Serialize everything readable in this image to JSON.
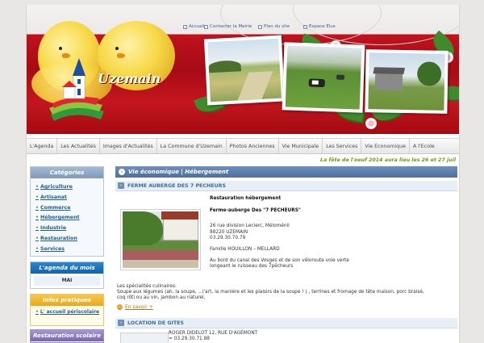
{
  "toplinks": {
    "accueil": "Accueil",
    "contact": "Contacter la Mairie",
    "plan": "Plan du site",
    "espace": "Espace Elus"
  },
  "logo": {
    "text": "Uzemain"
  },
  "nav": [
    "L'Agenda",
    "Les Actualités",
    "Images d'Actualités",
    "La Commune d'Uzemain",
    "Photos Anciennes",
    "Vie Municipale",
    "Les Services",
    "Vie Economique",
    "A l'Ecole"
  ],
  "ticker": "La fête de l'oeuf 2014 aura lieu les 26 et 27 juil",
  "sidebar": {
    "categories_title": "Catégories",
    "categories": [
      "Agriculture",
      "Artisanat",
      "Commerce",
      "Hébergement",
      "Industrie",
      "Restauration",
      "Services"
    ],
    "agenda_title": "L'agenda du mois",
    "agenda_month": "MAI",
    "infos_title": "Infos pratiques",
    "infos_item": "L' accueil périscolaire",
    "resto_title": "Restauration scolaire"
  },
  "main": {
    "header": "Vie économique | Hébergement",
    "section1": "FERME AUBERGE DES 7 PECHEURS",
    "a1_title": "Restauration hébergement",
    "a1_name": "Ferme-auberge Des \"7 PECHEURS\"",
    "a1_addr1": "26 rue division Leclerc, Méloménil",
    "a1_addr2": "88220 UZEMAIN",
    "a1_phone": "03.29.30.70.79",
    "a1_family": "Famille HOUILLON – MELLARD",
    "a1_desc1": "Au bord du canal des Vosges et de son véloroute voie verte",
    "a1_desc2": "longeant le ruisseau des 7pêcheurs",
    "a1_spec_title": "Les spécialités culinaires:",
    "a1_spec1": "Soupe aux légumes (ah, la soupe, ...l'art, la manière et les plaisirs de la soupe ! ) , terrines et fromage de tête maison, porc braisé,",
    "a1_spec2": "coq rôti ou au vin, jambon au naturel,",
    "more": "En savoir +",
    "section2": "LOCATION DE GITES",
    "a2_line1": "ROGER DIDELOT 12, RUE D'AGÉMONT",
    "a2_line2": "= 03.29.30.71.88"
  },
  "colors": {
    "brand_red": "#b3101a",
    "accent_green": "#6a9a19",
    "link_blue": "#1f5e98"
  }
}
